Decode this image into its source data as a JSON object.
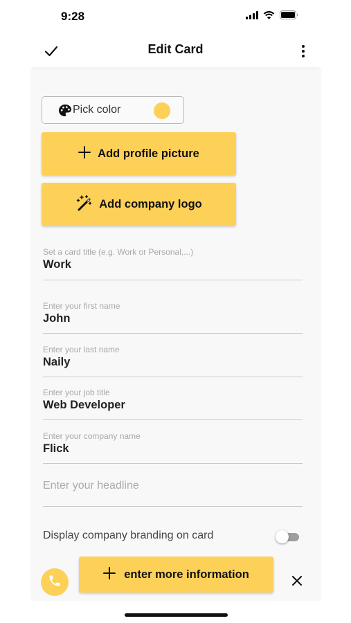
{
  "status_bar": {
    "time": "9:28"
  },
  "nav": {
    "title": "Edit Card",
    "confirm_icon": "checkmark-icon",
    "more_icon": "vertical-ellipsis-icon"
  },
  "colors": {
    "accent": "#fdd058",
    "selected_color": "#fdd058",
    "phone": "#fdd058"
  },
  "pick_color": {
    "label": "Pick color",
    "icon": "palette-icon"
  },
  "buttons": {
    "add_profile_picture": "Add profile picture",
    "add_company_logo": "Add company logo",
    "enter_more_information": "enter more information"
  },
  "fields": {
    "card_title": {
      "placeholder": "Set a card title (e.g. Work or Personal,...)",
      "value": "Work"
    },
    "first_name": {
      "placeholder": "Enter your first name",
      "value": "John"
    },
    "last_name": {
      "placeholder": "Enter your last name",
      "value": "Naily"
    },
    "job_title": {
      "placeholder": "Enter your job title",
      "value": "Web Developer"
    },
    "company_name": {
      "placeholder": "Enter your company name",
      "value": "Flick"
    },
    "headline": {
      "placeholder": "Enter your headline",
      "value": ""
    }
  },
  "branding": {
    "label": "Display company branding on card",
    "enabled": false
  }
}
